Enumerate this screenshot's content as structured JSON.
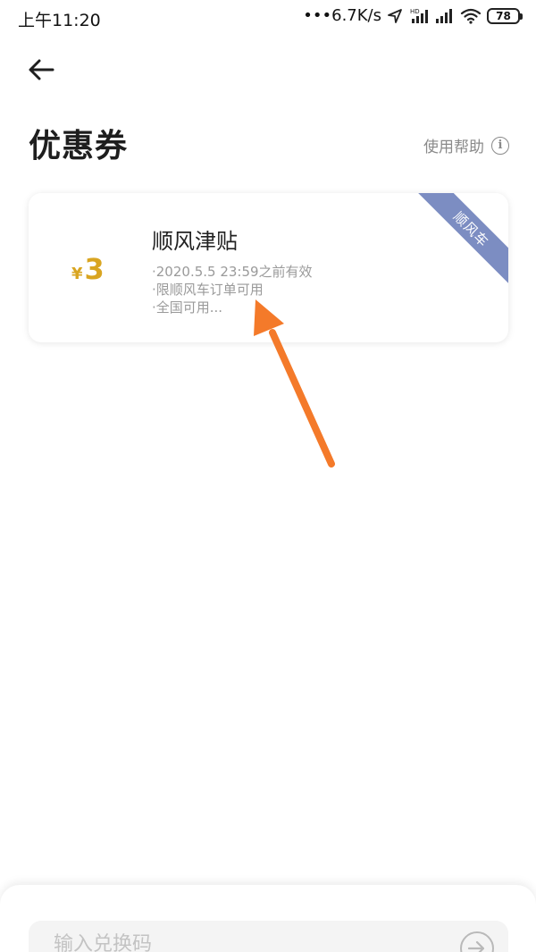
{
  "status_bar": {
    "time": "上午11:20",
    "network_speed": "•••6.7K/s",
    "battery_level": "78"
  },
  "header": {
    "title": "优惠券",
    "help_label": "使用帮助"
  },
  "coupon": {
    "currency_symbol": "¥",
    "amount": "3",
    "title": "顺风津贴",
    "details": [
      "·2020.5.5 23:59之前有效",
      "·限顺风车订单可用",
      "·全国可用..."
    ],
    "ribbon_label": "顺风车"
  },
  "redeem": {
    "placeholder": "输入兑换码"
  },
  "colors": {
    "coupon_amount": "#d9a521",
    "ribbon": "#7c8dc2",
    "annotation_arrow": "#f47a2a"
  },
  "icons": {
    "back": "arrow-left-icon",
    "help": "info-icon",
    "submit": "arrow-right-circle-icon"
  }
}
